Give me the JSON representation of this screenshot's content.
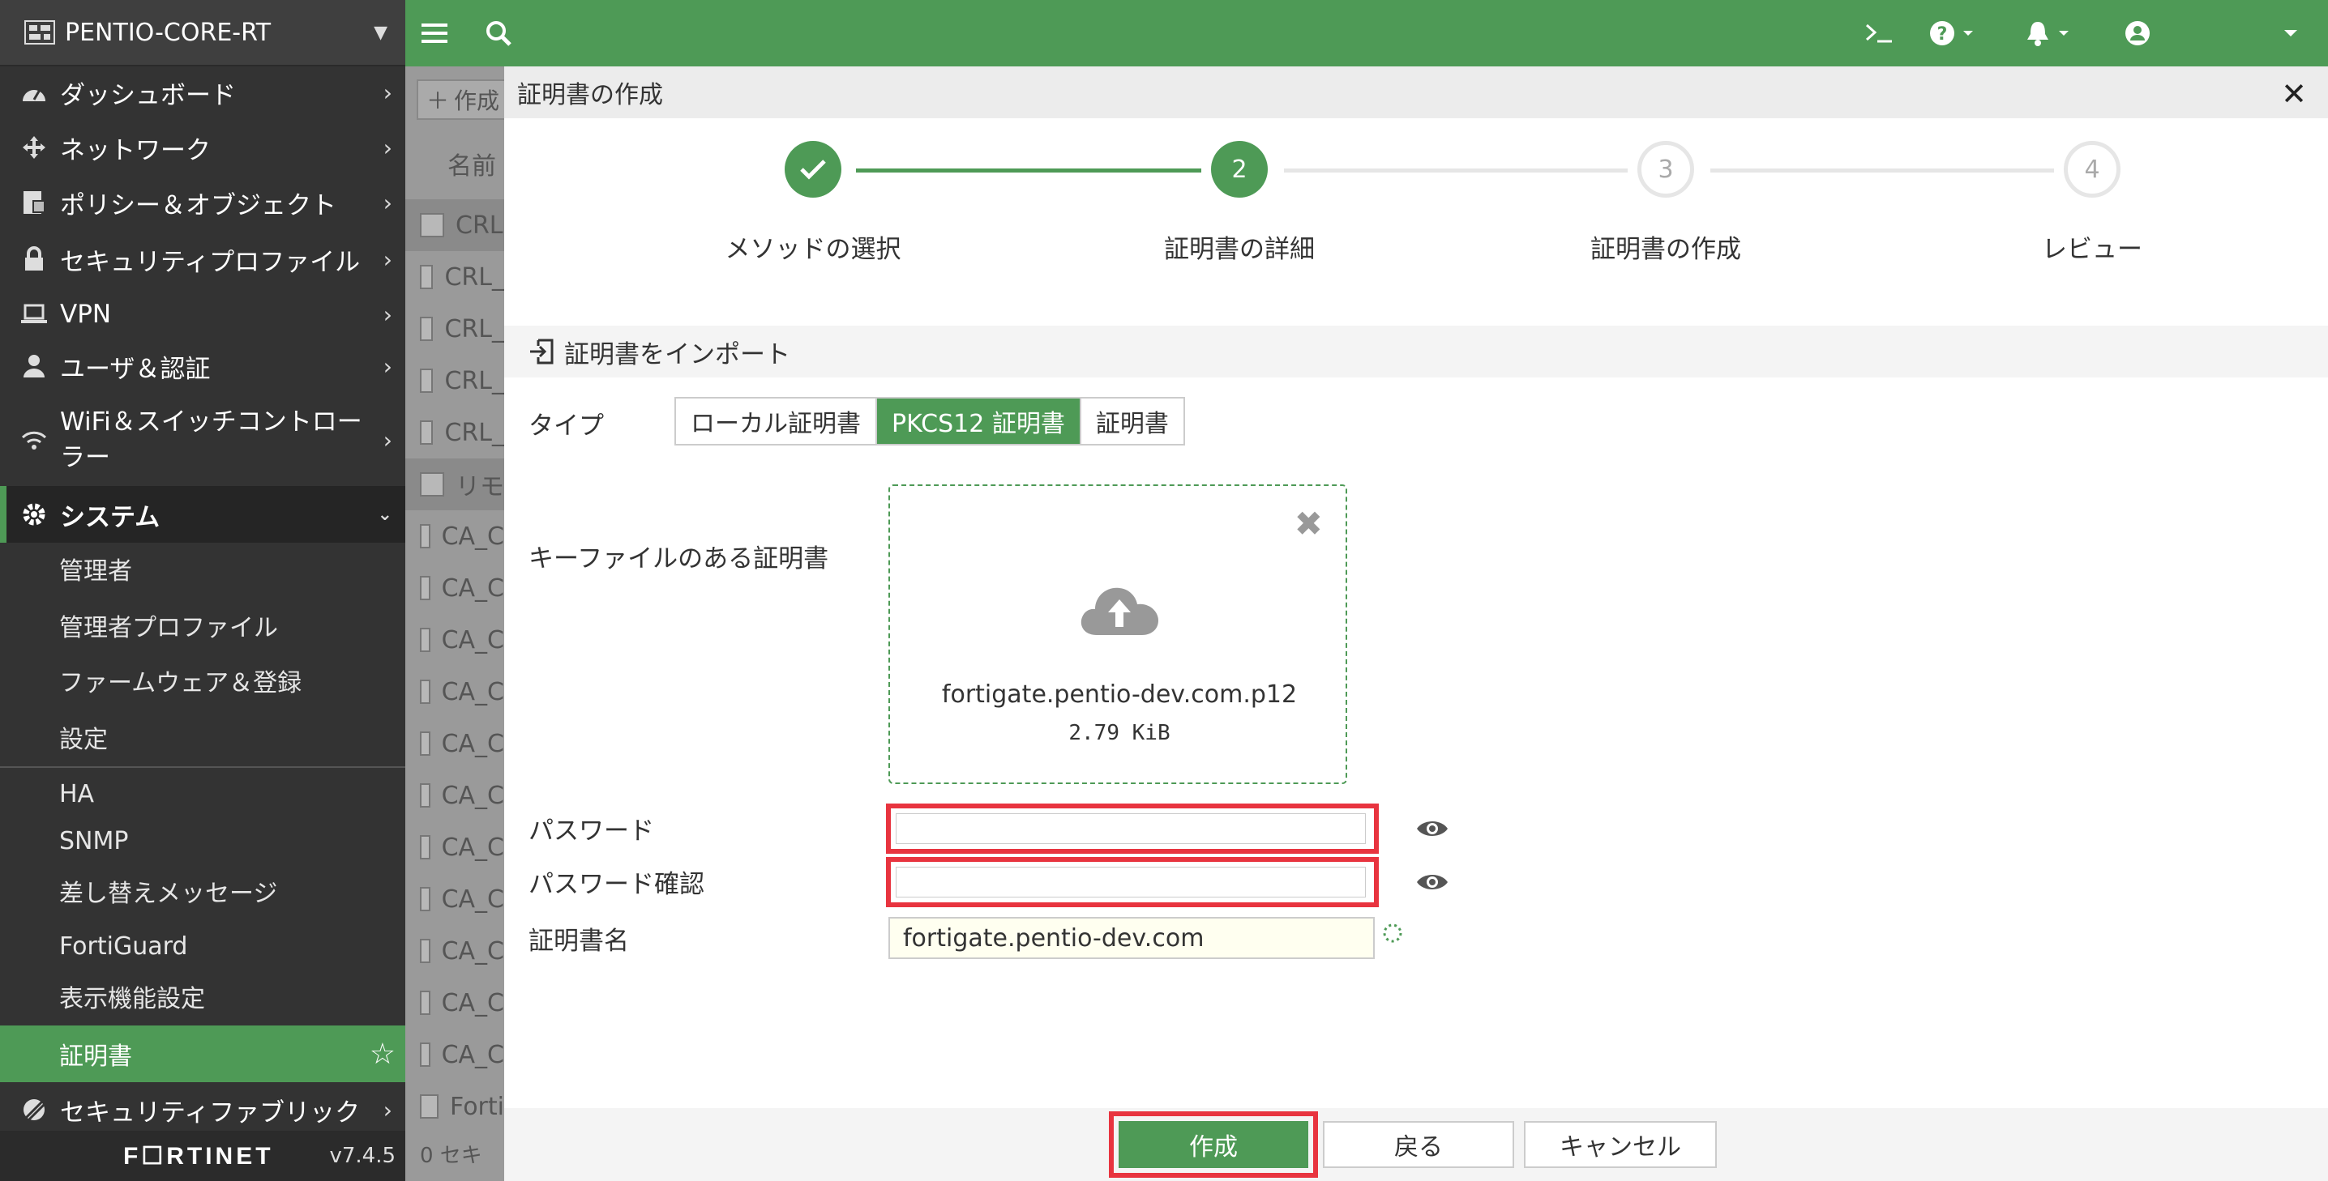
{
  "sidebar": {
    "device_name": "PENTIO-CORE-RT",
    "items": [
      {
        "label": "ダッシュボード",
        "icon": "dashboard-icon"
      },
      {
        "label": "ネットワーク",
        "icon": "network-icon"
      },
      {
        "label": "ポリシー＆オブジェクト",
        "icon": "policy-icon"
      },
      {
        "label": "セキュリティプロファイル",
        "icon": "lock-icon"
      },
      {
        "label": "VPN",
        "icon": "laptop-icon"
      },
      {
        "label": "ユーザ＆認証",
        "icon": "user-icon"
      },
      {
        "label": "WiFi＆スイッチコントローラー",
        "icon": "wifi-icon"
      }
    ],
    "system": {
      "label": "システム",
      "icon": "gear-icon"
    },
    "system_sub": [
      "管理者",
      "管理者プロファイル",
      "ファームウェア＆登録",
      "設定",
      "HA",
      "SNMP",
      "差し替えメッセージ",
      "FortiGuard",
      "表示機能設定",
      "証明書"
    ],
    "active_sub": "証明書",
    "fabric": {
      "label": "セキュリティファブリック",
      "icon": "fabric-icon"
    },
    "logo": "F☐RTINET",
    "version": "v7.4.5"
  },
  "background_list": {
    "create_button": "作成",
    "column_header": "名前",
    "rows": [
      "CRL",
      "CRL_",
      "CRL_",
      "CRL_",
      "CRL_",
      "リモ",
      "CA_C",
      "CA_C",
      "CA_C",
      "CA_C",
      "CA_C",
      "CA_C",
      "CA_C",
      "CA_C",
      "CA_C",
      "CA_C",
      "CA_C",
      "Forti",
      "0 セキ"
    ]
  },
  "dialog": {
    "title": "証明書の作成",
    "steps": [
      {
        "label": "メソッドの選択",
        "number": "",
        "state": "done"
      },
      {
        "label": "証明書の詳細",
        "number": "2",
        "state": "current"
      },
      {
        "label": "証明書の作成",
        "number": "3",
        "state": "todo"
      },
      {
        "label": "レビュー",
        "number": "4",
        "state": "todo"
      }
    ],
    "section_title": "証明書をインポート",
    "type_label": "タイプ",
    "type_options": [
      "ローカル証明書",
      "PKCS12 証明書",
      "証明書"
    ],
    "type_selected": "PKCS12 証明書",
    "keyfile_label": "キーファイルのある証明書",
    "file_name": "fortigate.pentio-dev.com.p12",
    "file_size": "2.79 KiB",
    "password_label": "パスワード",
    "password_value": "",
    "password_confirm_label": "パスワード確認",
    "password_confirm_value": "",
    "cert_name_label": "証明書名",
    "cert_name_value": "fortigate.pentio-dev.com",
    "buttons": {
      "create": "作成",
      "back": "戻る",
      "cancel": "キャンセル"
    }
  },
  "colors": {
    "accent": "#4e9a56",
    "highlight": "#e8343f",
    "sidebar_bg": "#333333"
  }
}
